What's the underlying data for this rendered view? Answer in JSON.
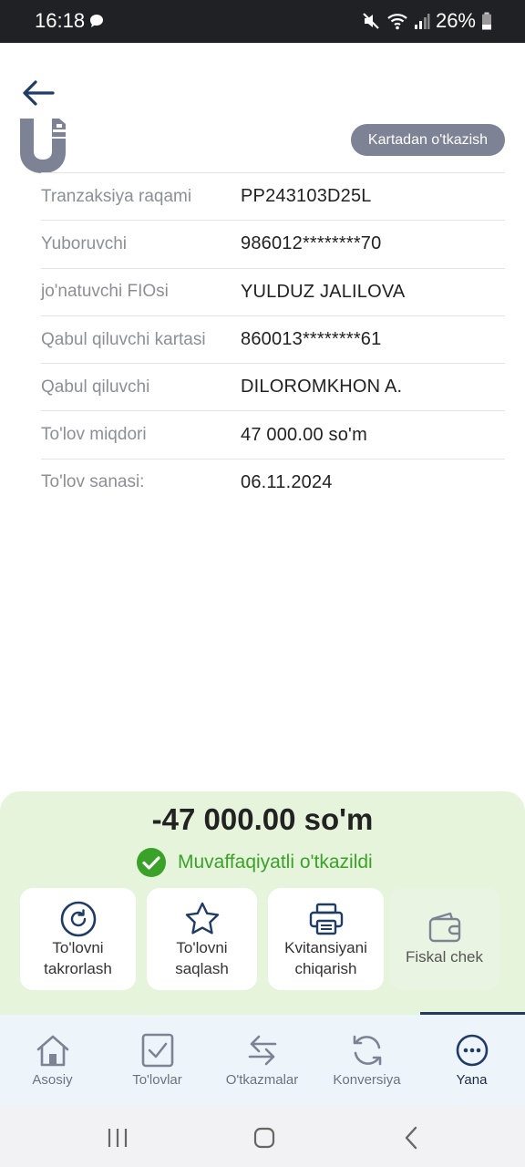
{
  "status_bar": {
    "time": "16:18",
    "battery": "26%",
    "icons": [
      "chat-icon",
      "mute-icon",
      "wifi-icon",
      "signal-icon",
      "battery-icon"
    ]
  },
  "header": {
    "back_icon": "arrow-left-icon",
    "logo": "uzcard-logo",
    "type_badge": "Kartadan o'tkazish"
  },
  "details": [
    {
      "label": "Tranzaksiya raqami",
      "value": "PP243103D25L"
    },
    {
      "label": "Yuboruvchi",
      "value": "986012********70"
    },
    {
      "label": "jo'natuvchi FIOsi",
      "value": "YULDUZ JALILOVA"
    },
    {
      "label": "Qabul qiluvchi kartasi",
      "value": "860013********61"
    },
    {
      "label": "Qabul qiluvchi",
      "value": "DILOROMKHON A."
    },
    {
      "label": "To'lov miqdori",
      "value": "47 000.00 so'm"
    },
    {
      "label": "To'lov sanasi:",
      "value": "06.11.2024"
    }
  ],
  "summary": {
    "amount": "-47 000.00 so'm",
    "status_text": "Muvaffaqiyatli o'tkazildi",
    "status_color": "#3aa228",
    "panel_color": "#e6f4dc"
  },
  "actions": [
    {
      "line1": "To'lovni",
      "line2": "takrorlash",
      "icon": "repeat-icon"
    },
    {
      "line1": "To'lovni",
      "line2": "saqlash",
      "icon": "star-icon"
    },
    {
      "line1": "Kvitansiyani",
      "line2": "chiqarish",
      "icon": "printer-icon"
    },
    {
      "line1": "Fiskal chek",
      "line2": "",
      "icon": "wallet-icon"
    }
  ],
  "bottom_nav": {
    "items": [
      {
        "label": "Asosiy",
        "icon": "home-icon"
      },
      {
        "label": "To'lovlar",
        "icon": "checkbox-icon"
      },
      {
        "label": "O'tkazmalar",
        "icon": "transfer-icon"
      },
      {
        "label": "Konversiya",
        "icon": "refresh-icon"
      },
      {
        "label": "Yana",
        "icon": "more-icon"
      }
    ],
    "active": "Yana",
    "accent": "#1f3b66"
  }
}
